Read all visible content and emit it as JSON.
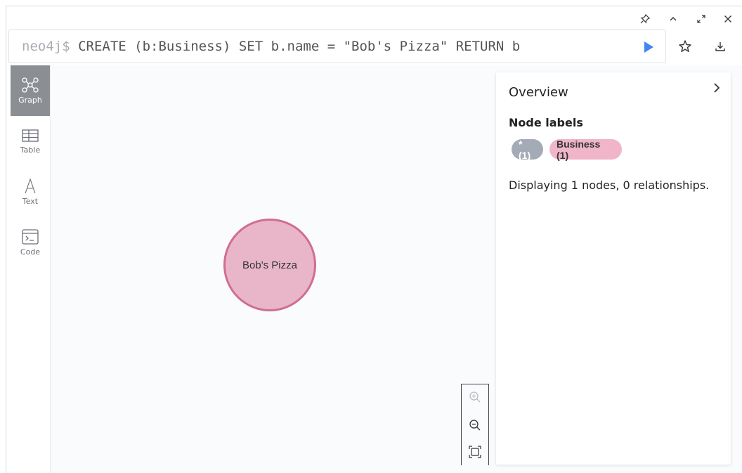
{
  "query": {
    "prompt": "neo4j$",
    "text": "CREATE (b:Business) SET b.name = \"Bob's Pizza\" RETURN b"
  },
  "window_controls": {
    "icons": [
      "pin-icon",
      "collapse-up-icon",
      "fullscreen-icon",
      "close-icon"
    ]
  },
  "toolbar": {
    "icons": [
      "play-icon",
      "star-icon",
      "download-icon"
    ],
    "accent": "#4285f4"
  },
  "sidebar": {
    "items": [
      {
        "label": "Graph",
        "icon": "graph-icon",
        "active": true
      },
      {
        "label": "Table",
        "icon": "table-icon",
        "active": false
      },
      {
        "label": "Text",
        "icon": "text-icon",
        "active": false
      },
      {
        "label": "Code",
        "icon": "code-icon",
        "active": false
      }
    ]
  },
  "graph": {
    "node_label": "Bob's Pizza",
    "node_fill": "#e8b6c8",
    "node_border": "#d16c93"
  },
  "overview": {
    "title": "Overview",
    "node_labels_heading": "Node labels",
    "pills": [
      {
        "label": "* (1)",
        "color": "#a5abb6"
      },
      {
        "label": "Business (1)",
        "color": "#f0b5c8"
      }
    ],
    "summary": "Displaying 1 nodes, 0 relationships."
  }
}
